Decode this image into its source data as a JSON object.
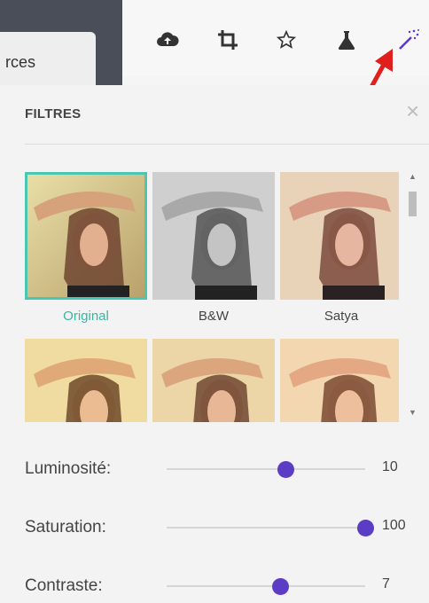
{
  "tab": {
    "label": "rces"
  },
  "panel": {
    "title": "FILTRES",
    "close_glyph": "×"
  },
  "toolbar": {
    "icons": [
      "cloud-upload-icon",
      "crop-icon",
      "star-icon",
      "flask-icon",
      "magic-wand-icon"
    ]
  },
  "filters": [
    {
      "name": "Original",
      "selected": true
    },
    {
      "name": "B&W",
      "selected": false
    },
    {
      "name": "Satya",
      "selected": false
    }
  ],
  "sliders": [
    {
      "label": "Luminosité:",
      "value": "10",
      "fraction": 0.6
    },
    {
      "label": "Saturation:",
      "value": "100",
      "fraction": 1.0
    },
    {
      "label": "Contraste:",
      "value": "7",
      "fraction": 0.57
    }
  ],
  "colors": {
    "accent": "#4bc6b3",
    "knob": "#5b3cc4",
    "arrow": "#e0201c"
  }
}
